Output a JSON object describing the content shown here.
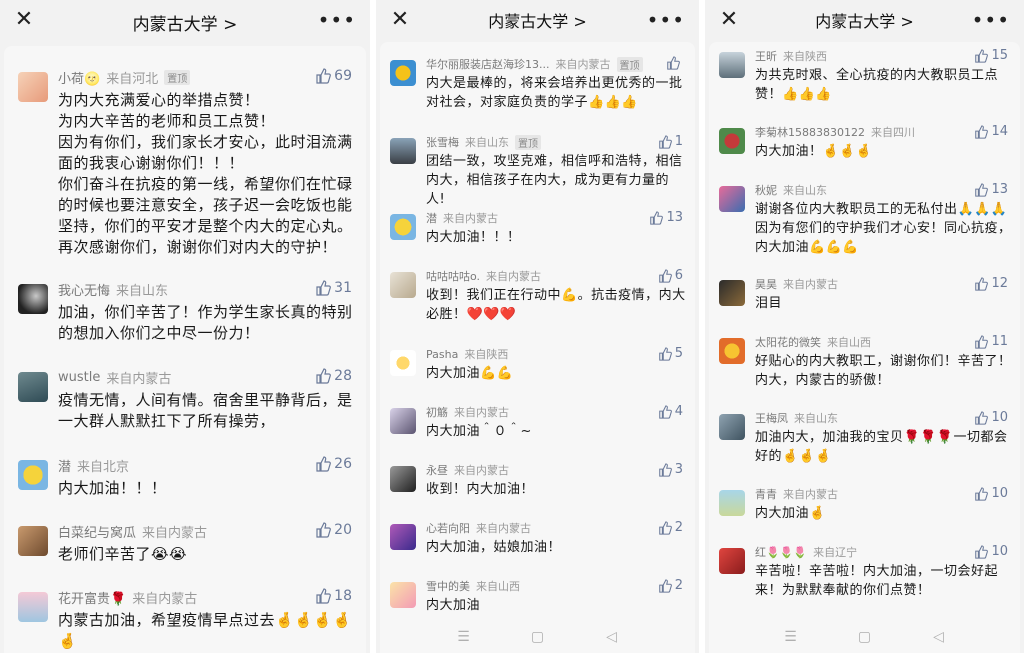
{
  "panels": [
    {
      "title": "内蒙古大学 >",
      "comments": [
        {
          "name": "小荷🌝",
          "from": "来自河北",
          "pinned": "置顶",
          "likes": "69",
          "text": "为内大充满爱心的举措点赞！\n为内大辛苦的老师和员工点赞！\n因为有你们，我们家长才安心，此时泪流满面的我衷心谢谢你们！！！\n你们奋斗在抗疫的第一线，希望你们在忙碌的时候也要注意安全，孩子迟一会吃饭也能坚持，你们的平安才是整个内大的定心丸。\n再次感谢你们，谢谢你们对内大的守护！"
        },
        {
          "name": "我心无悔",
          "from": "来自山东",
          "pinned": "",
          "likes": "31",
          "text": "加油，你们辛苦了！作为学生家长真的特别的想加入你们之中尽一份力！"
        },
        {
          "name": "wustle",
          "from": "来自内蒙古",
          "pinned": "",
          "likes": "28",
          "text": "疫情无情，人间有情。宿舍里平静背后，是一大群人默默扛下了所有操劳，"
        },
        {
          "name": "潜",
          "from": "来自北京",
          "pinned": "",
          "likes": "26",
          "text": "内大加油！！！"
        },
        {
          "name": "白菜纪与窝瓜",
          "from": "来自内蒙古",
          "pinned": "",
          "likes": "20",
          "text": "老师们辛苦了😭😭"
        },
        {
          "name": "花开富贵🌹",
          "from": "来自内蒙古",
          "pinned": "",
          "likes": "18",
          "text": "内蒙古加油，希望疫情早点过去🤞🤞🤞🤞🤞"
        }
      ]
    },
    {
      "title": "内蒙古大学 >",
      "comments": [
        {
          "name": "华尔丽服装店赵海珍13...",
          "from": "来自内蒙古",
          "pinned": "置顶",
          "likes": "",
          "text": "内大是最棒的，将来会培养出更优秀的一批对社会，对家庭负责的学子👍👍👍"
        },
        {
          "name": "张雪梅",
          "from": "来自山东",
          "pinned": "置顶",
          "likes": "1",
          "text": "团结一致，攻坚克难，相信呼和浩特，相信内大，相信孩子在内大，成为更有力量的人!"
        },
        {
          "name": "潜",
          "from": "来自内蒙古",
          "pinned": "",
          "likes": "13",
          "text": "内大加油！！！"
        },
        {
          "name": "咕咕咕咕o.",
          "from": "来自内蒙古",
          "pinned": "",
          "likes": "6",
          "text": "收到！我们正在行动中💪。抗击疫情，内大必胜！❤️❤️❤️"
        },
        {
          "name": "Pasha",
          "from": "来自陕西",
          "pinned": "",
          "likes": "5",
          "text": "内大加油💪💪"
        },
        {
          "name": "初觞",
          "from": "来自内蒙古",
          "pinned": "",
          "likes": "4",
          "text": "内大加油＾０＾~"
        },
        {
          "name": "永昼",
          "from": "来自内蒙古",
          "pinned": "",
          "likes": "3",
          "text": "收到！内大加油！"
        },
        {
          "name": "心若向阳",
          "from": "来自内蒙古",
          "pinned": "",
          "likes": "2",
          "text": "内大加油，姑娘加油！"
        },
        {
          "name": "雪中的美",
          "from": "来自山西",
          "pinned": "",
          "likes": "2",
          "text": "内大加油"
        }
      ]
    },
    {
      "title": "内蒙古大学 >",
      "comments": [
        {
          "name": "王昕",
          "from": "来自陕西",
          "pinned": "",
          "likes": "15",
          "text": "为共克时艰、全心抗疫的内大教职员工点赞！👍👍👍"
        },
        {
          "name": "李菊林15883830122",
          "from": "来自四川",
          "pinned": "",
          "likes": "14",
          "text": "内大加油！🤞🤞🤞"
        },
        {
          "name": "秋妮",
          "from": "来自山东",
          "pinned": "",
          "likes": "13",
          "text": "谢谢各位内大教职员工的无私付出🙏🙏🙏因为有您们的守护我们才心安！同心抗疫，内大加油💪💪💪"
        },
        {
          "name": "昊昊",
          "from": "来自内蒙古",
          "pinned": "",
          "likes": "12",
          "text": "泪目"
        },
        {
          "name": "太阳花的微笑",
          "from": "来自山西",
          "pinned": "",
          "likes": "11",
          "text": "好贴心的内大教职工，谢谢你们！辛苦了！内大，内蒙古的骄傲！"
        },
        {
          "name": "王梅凤",
          "from": "来自山东",
          "pinned": "",
          "likes": "10",
          "text": "加油内大，加油我的宝贝🌹🌹🌹一切都会好的🤞🤞🤞"
        },
        {
          "name": "青青",
          "from": "来自内蒙古",
          "pinned": "",
          "likes": "10",
          "text": "内大加油🤞"
        },
        {
          "name": "红🌷🌷🌷",
          "from": "来自辽宁",
          "pinned": "",
          "likes": "10",
          "text": "辛苦啦！辛苦啦！内大加油，一切会好起来！为默默奉献的你们点赞！"
        }
      ]
    }
  ],
  "icons": {
    "close": "close-icon",
    "more": "more-icon",
    "like": "thumb-up-icon",
    "nav": [
      "menu-nav-icon",
      "home-nav-icon",
      "back-nav-icon"
    ]
  },
  "colors": {
    "like": "#6b7a99",
    "meta": "#8a8a8a",
    "text": "#191919",
    "card": "#f7f7f7",
    "page": "#f2f2f2"
  }
}
